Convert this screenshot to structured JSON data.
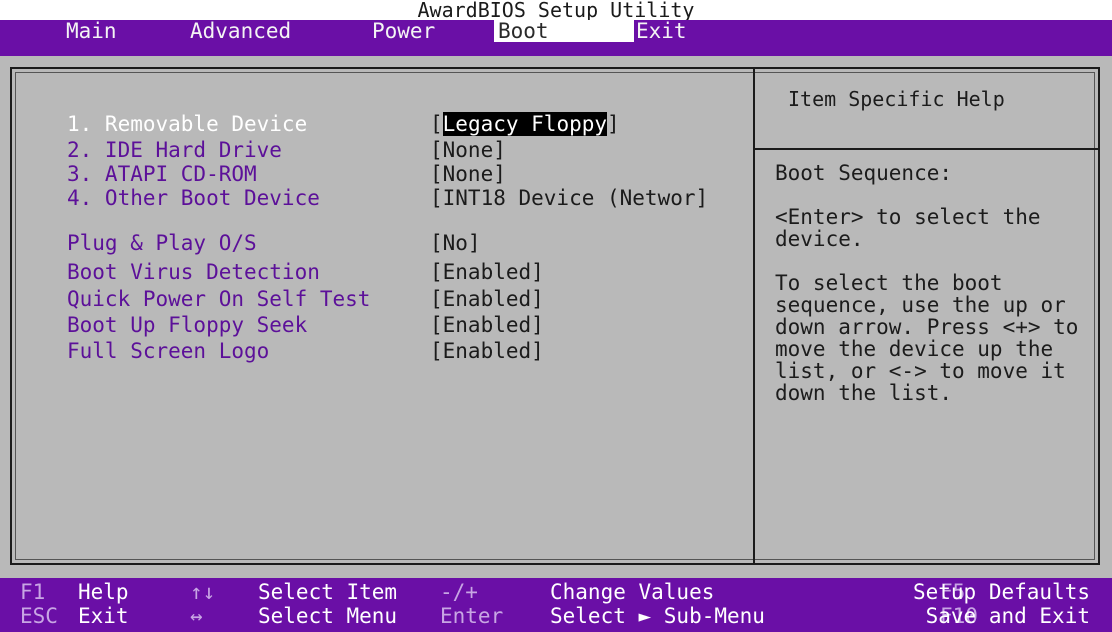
{
  "title": "AwardBIOS Setup Utility",
  "menu": [
    {
      "label": "Main"
    },
    {
      "label": "Advanced"
    },
    {
      "label": "Power"
    },
    {
      "label": "Boot"
    },
    {
      "label": "Exit"
    }
  ],
  "active_menu": "Boot",
  "options": [
    {
      "label": "1. Removable Device",
      "value_open": "[",
      "value": "Legacy Floppy",
      "value_close": "]"
    },
    {
      "label": "2. IDE Hard Drive",
      "value": "[None]"
    },
    {
      "label": "3. ATAPI CD-ROM",
      "value": "[None]"
    },
    {
      "label": "4. Other Boot Device",
      "value": "[INT18 Device (Networ]"
    },
    {
      "label": "Plug & Play O/S",
      "value": "[No]"
    },
    {
      "label": "Boot Virus Detection",
      "value": "[Enabled]"
    },
    {
      "label": "Quick Power On Self Test",
      "value": "[Enabled]"
    },
    {
      "label": "Boot Up Floppy Seek",
      "value": "[Enabled]"
    },
    {
      "label": "Full Screen Logo",
      "value": "[Enabled]"
    }
  ],
  "help": {
    "title": "Item Specific Help",
    "text": "Boot Sequence:\n\n<Enter> to select the\ndevice.\n\nTo select the boot\nsequence, use the up or\ndown arrow. Press <+> to\nmove the device up the\nlist, or <-> to move it\ndown the list."
  },
  "footer": [
    {
      "key": "F1",
      "desc": "Help"
    },
    {
      "key": "ESC",
      "desc": "Exit"
    },
    {
      "key": "↑↓",
      "desc": "Select Item"
    },
    {
      "key": "↔",
      "desc": "Select Menu"
    },
    {
      "key": "-/+",
      "desc": "Change Values"
    },
    {
      "key": "Enter",
      "desc": "Select ► Sub-Menu"
    },
    {
      "key": "F5",
      "desc": "Setup Defaults"
    },
    {
      "key": "F10",
      "desc": "Save and Exit"
    }
  ],
  "colors": {
    "background": "#b9b9b9",
    "menu_bar": "#6a0fa6",
    "option_label": "#5c1099"
  }
}
